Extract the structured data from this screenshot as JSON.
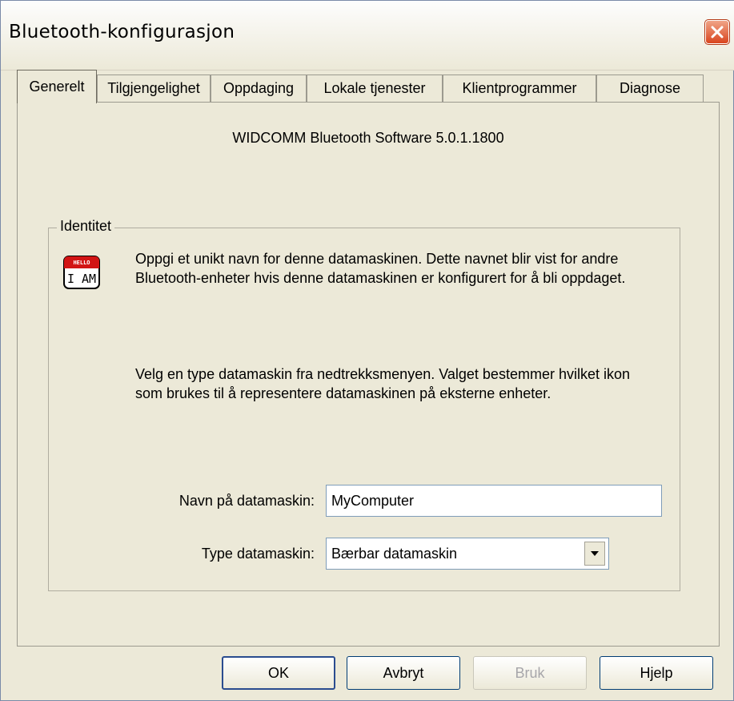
{
  "window": {
    "title": "Bluetooth-konfigurasjon"
  },
  "tabs": [
    {
      "label": "Generelt",
      "active": true
    },
    {
      "label": "Tilgjengelighet",
      "active": false
    },
    {
      "label": "Oppdaging",
      "active": false
    },
    {
      "label": "Lokale tjenester",
      "active": false
    },
    {
      "label": "Klientprogrammer",
      "active": false
    },
    {
      "label": "Diagnose",
      "active": false
    }
  ],
  "panel": {
    "version_text": "WIDCOMM Bluetooth Software 5.0.1.1800",
    "group_label": "Identitet",
    "icon_text_top": "HELLO",
    "icon_text": "I AM",
    "paragraph1": "Oppgi et unikt navn for denne datamaskinen. Dette navnet blir vist for andre Bluetooth-enheter hvis denne datamaskinen er konfigurert for å bli oppdaget.",
    "paragraph2": "Velg en type datamaskin fra nedtrekksmenyen. Valget bestemmer hvilket ikon som brukes til å representere datamaskinen på eksterne enheter.",
    "name_label": "Navn på datamaskin:",
    "name_value": "MyComputer",
    "type_label": "Type datamaskin:",
    "type_value": "Bærbar datamaskin"
  },
  "buttons": {
    "ok": "OK",
    "cancel": "Avbryt",
    "apply": "Bruk",
    "help": "Hjelp"
  },
  "icons": {
    "close": "close-icon",
    "identity": "hello-i-am-icon",
    "dropdown": "chevron-down-icon"
  },
  "colors": {
    "dialog_background": "#ece9d8",
    "close_button": "#d9451f",
    "icon_red": "#d21414"
  }
}
